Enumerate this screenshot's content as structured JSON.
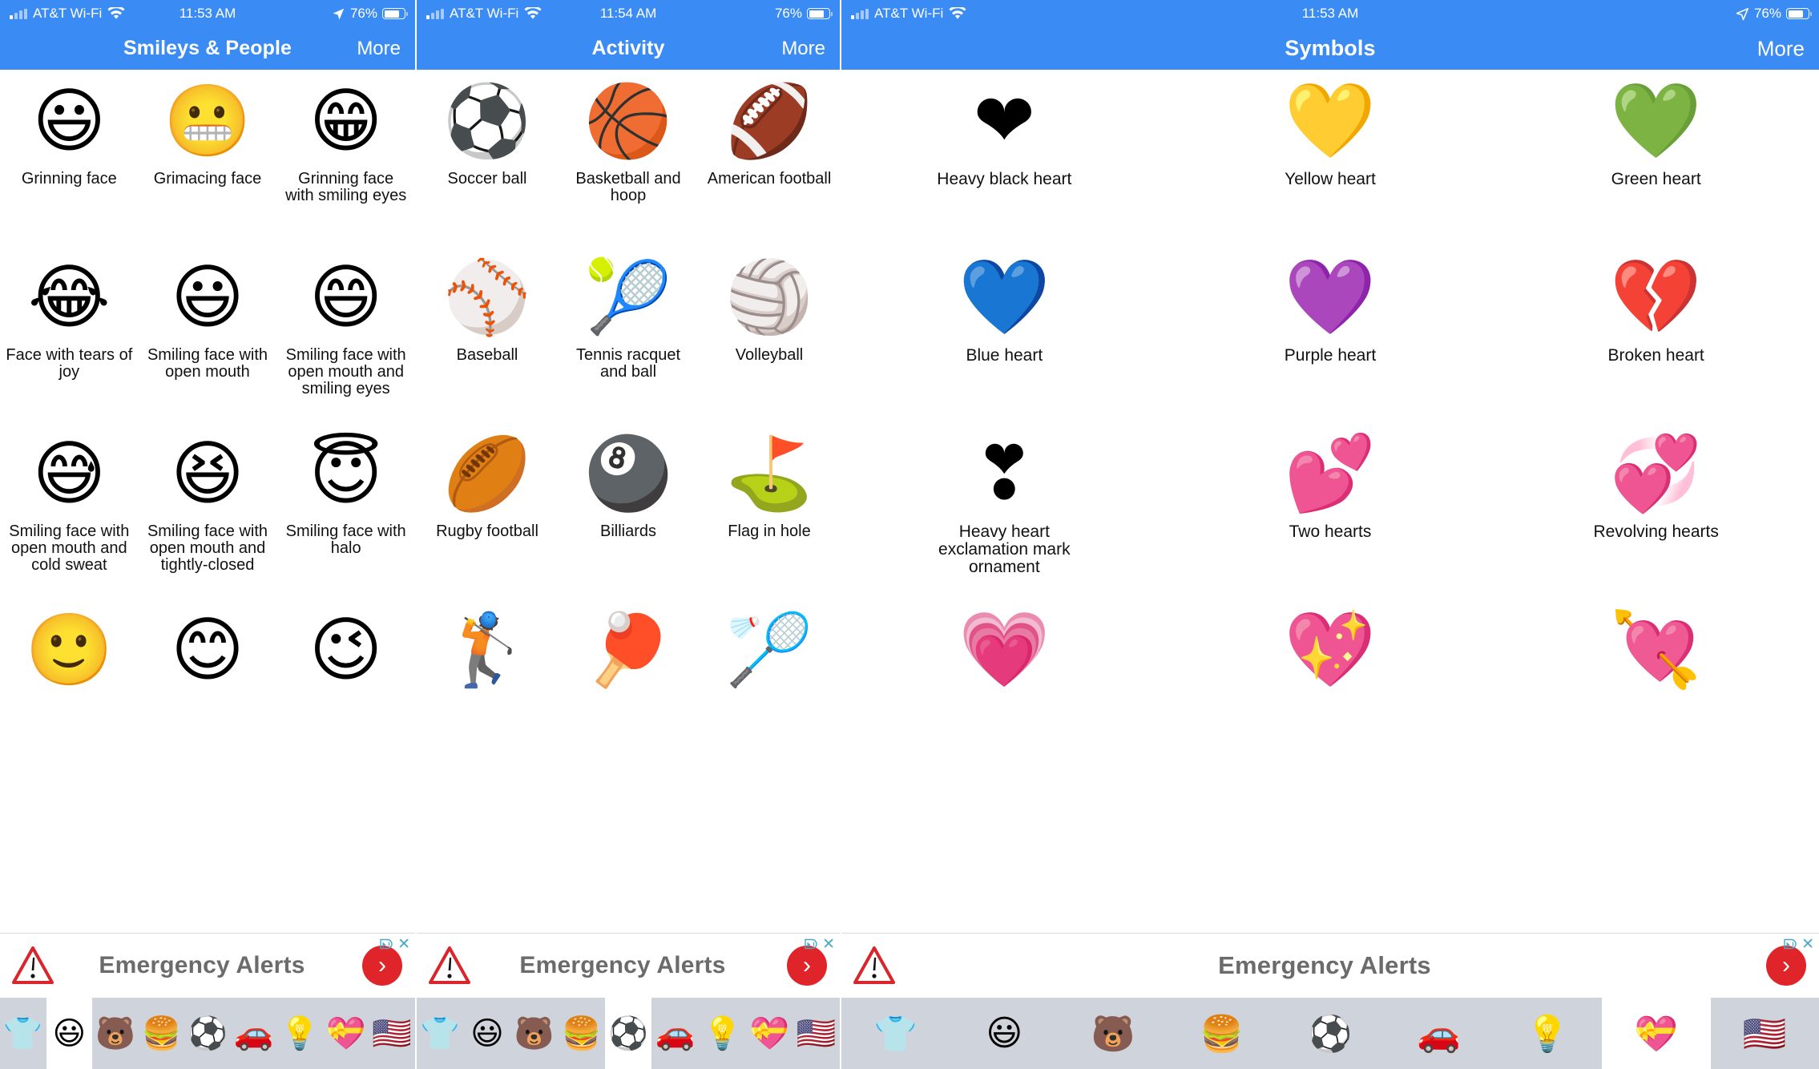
{
  "panels": [
    {
      "id": "smileys-people",
      "status": {
        "carrier": "AT&T Wi-Fi",
        "signal_icon": "signal-bars-icon",
        "wifi_icon": "wifi-icon",
        "time": "11:53 AM",
        "location_icon": "location-arrow-icon",
        "battery_percent": "76%",
        "battery_icon": "battery-icon"
      },
      "nav": {
        "title": "Smileys & People",
        "more_label": "More"
      },
      "cells": [
        {
          "glyph": "😃",
          "label": "Grinning face",
          "name": "grinning-face"
        },
        {
          "glyph": "😬",
          "label": "Grimacing face",
          "name": "grimacing-face"
        },
        {
          "glyph": "😁",
          "label": "Grinning face with smiling eyes",
          "name": "grinning-face-with-smiling-eyes"
        },
        {
          "glyph": "😂",
          "label": "Face with tears of joy",
          "name": "face-with-tears-of-joy"
        },
        {
          "glyph": "😃",
          "label": "Smiling face with open mouth",
          "name": "smiling-face-with-open-mouth"
        },
        {
          "glyph": "😄",
          "label": "Smiling face with open mouth and smiling eyes",
          "name": "smiling-face-with-open-mouth-and-smiling-eyes"
        },
        {
          "glyph": "😅",
          "label": "Smiling face with open mouth and cold sweat",
          "name": "smiling-face-with-open-mouth-and-cold-sweat"
        },
        {
          "glyph": "😆",
          "label": "Smiling face with open mouth and tightly-closed",
          "name": "smiling-face-with-open-mouth-and-tightly-closed"
        },
        {
          "glyph": "😇",
          "label": "Smiling face with halo",
          "name": "smiling-face-with-halo"
        },
        {
          "glyph": "🙂",
          "label": "",
          "name": "partial-row-cell"
        },
        {
          "glyph": "😊",
          "label": "",
          "name": "partial-row-cell"
        },
        {
          "glyph": "😉",
          "label": "",
          "name": "partial-row-cell"
        }
      ],
      "ad": {
        "title": "Emergency Alerts",
        "cta_icon": "chevron-right-icon",
        "adchoices_icon": "adchoices-icon",
        "close_icon": "close-icon"
      },
      "tabs": [
        {
          "glyph": "👕",
          "name": "tab-clothing",
          "selected": false
        },
        {
          "glyph": "😃",
          "name": "tab-smileys-people",
          "selected": true
        },
        {
          "glyph": "🐻",
          "name": "tab-animals-nature",
          "selected": false
        },
        {
          "glyph": "🍔",
          "name": "tab-food-drink",
          "selected": false
        },
        {
          "glyph": "⚽",
          "name": "tab-activity",
          "selected": false
        },
        {
          "glyph": "🚗",
          "name": "tab-travel-places",
          "selected": false
        },
        {
          "glyph": "💡",
          "name": "tab-objects",
          "selected": false
        },
        {
          "glyph": "💝",
          "name": "tab-symbols",
          "selected": false
        },
        {
          "glyph": "🇺🇸",
          "name": "tab-flags",
          "selected": false
        }
      ]
    },
    {
      "id": "activity",
      "status": {
        "carrier": "AT&T Wi-Fi",
        "signal_icon": "signal-bars-icon",
        "wifi_icon": "wifi-icon",
        "time": "11:54 AM",
        "location_icon": "",
        "battery_percent": "76%",
        "battery_icon": "battery-icon"
      },
      "nav": {
        "title": "Activity",
        "more_label": "More"
      },
      "cells": [
        {
          "glyph": "⚽",
          "label": "Soccer ball",
          "name": "soccer-ball"
        },
        {
          "glyph": "🏀",
          "label": "Basketball and hoop",
          "name": "basketball-and-hoop"
        },
        {
          "glyph": "🏈",
          "label": "American football",
          "name": "american-football"
        },
        {
          "glyph": "⚾",
          "label": "Baseball",
          "name": "baseball"
        },
        {
          "glyph": "🎾",
          "label": "Tennis racquet and ball",
          "name": "tennis-racquet-and-ball"
        },
        {
          "glyph": "🏐",
          "label": "Volleyball",
          "name": "volleyball"
        },
        {
          "glyph": "🏉",
          "label": "Rugby football",
          "name": "rugby-football"
        },
        {
          "glyph": "🎱",
          "label": "Billiards",
          "name": "billiards"
        },
        {
          "glyph": "⛳",
          "label": "Flag in hole",
          "name": "flag-in-hole"
        },
        {
          "glyph": "🏌",
          "label": "",
          "name": "partial-row-cell"
        },
        {
          "glyph": "🏓",
          "label": "",
          "name": "partial-row-cell"
        },
        {
          "glyph": "🏸",
          "label": "",
          "name": "partial-row-cell"
        }
      ],
      "ad": {
        "title": "Emergency Alerts",
        "cta_icon": "chevron-right-icon",
        "adchoices_icon": "adchoices-icon",
        "close_icon": "close-icon"
      },
      "tabs": [
        {
          "glyph": "👕",
          "name": "tab-clothing",
          "selected": false
        },
        {
          "glyph": "😃",
          "name": "tab-smileys-people",
          "selected": false
        },
        {
          "glyph": "🐻",
          "name": "tab-animals-nature",
          "selected": false
        },
        {
          "glyph": "🍔",
          "name": "tab-food-drink",
          "selected": false
        },
        {
          "glyph": "⚽",
          "name": "tab-activity",
          "selected": true
        },
        {
          "glyph": "🚗",
          "name": "tab-travel-places",
          "selected": false
        },
        {
          "glyph": "💡",
          "name": "tab-objects",
          "selected": false
        },
        {
          "glyph": "💝",
          "name": "tab-symbols",
          "selected": false
        },
        {
          "glyph": "🇺🇸",
          "name": "tab-flags",
          "selected": false
        }
      ]
    },
    {
      "id": "symbols",
      "status": {
        "carrier": "AT&T Wi-Fi",
        "signal_icon": "signal-bars-icon",
        "wifi_icon": "wifi-icon",
        "time": "11:53 AM",
        "location_icon": "location-arrow-icon",
        "battery_percent": "76%",
        "battery_icon": "battery-icon"
      },
      "nav": {
        "title": "Symbols",
        "more_label": "More"
      },
      "cells": [
        {
          "glyph": "❤",
          "label": "Heavy black heart",
          "name": "heavy-black-heart"
        },
        {
          "glyph": "💛",
          "label": "Yellow heart",
          "name": "yellow-heart"
        },
        {
          "glyph": "💚",
          "label": "Green heart",
          "name": "green-heart"
        },
        {
          "glyph": "💙",
          "label": "Blue heart",
          "name": "blue-heart"
        },
        {
          "glyph": "💜",
          "label": "Purple heart",
          "name": "purple-heart"
        },
        {
          "glyph": "💔",
          "label": "Broken heart",
          "name": "broken-heart"
        },
        {
          "glyph": "❣",
          "label": "Heavy heart exclamation mark ornament",
          "name": "heavy-heart-exclamation-mark-ornament"
        },
        {
          "glyph": "💕",
          "label": "Two hearts",
          "name": "two-hearts"
        },
        {
          "glyph": "💞",
          "label": "Revolving hearts",
          "name": "revolving-hearts"
        },
        {
          "glyph": "💗",
          "label": "",
          "name": "partial-row-cell"
        },
        {
          "glyph": "💖",
          "label": "",
          "name": "partial-row-cell"
        },
        {
          "glyph": "💘",
          "label": "",
          "name": "partial-row-cell"
        }
      ],
      "ad": {
        "title": "Emergency Alerts",
        "cta_icon": "chevron-right-icon",
        "adchoices_icon": "adchoices-icon",
        "close_icon": "close-icon"
      },
      "tabs": [
        {
          "glyph": "👕",
          "name": "tab-clothing",
          "selected": false
        },
        {
          "glyph": "😃",
          "name": "tab-smileys-people",
          "selected": false
        },
        {
          "glyph": "🐻",
          "name": "tab-animals-nature",
          "selected": false
        },
        {
          "glyph": "🍔",
          "name": "tab-food-drink",
          "selected": false
        },
        {
          "glyph": "⚽",
          "name": "tab-activity",
          "selected": false
        },
        {
          "glyph": "🚗",
          "name": "tab-travel-places",
          "selected": false
        },
        {
          "glyph": "💡",
          "name": "tab-objects",
          "selected": false
        },
        {
          "glyph": "💝",
          "name": "tab-symbols",
          "selected": true
        },
        {
          "glyph": "🇺🇸",
          "name": "tab-flags",
          "selected": false
        }
      ]
    }
  ],
  "colors": {
    "nav_blue": "#3b8bf5",
    "tabbar_grey": "#cfd4dc",
    "ad_red": "#e0252a",
    "ad_text_grey": "#6b6b6b",
    "adchoices_blue": "#4aa8c8"
  }
}
